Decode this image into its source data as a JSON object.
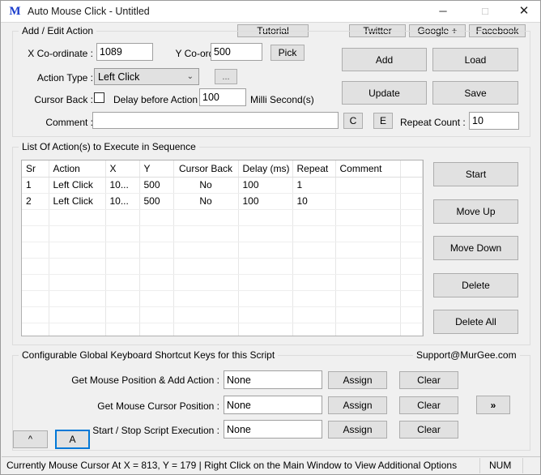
{
  "window": {
    "title": "Auto Mouse Click - Untitled",
    "icon": "M",
    "minimize": "─",
    "maximize": "□",
    "close": "✕"
  },
  "links": {
    "tutorial": "Tutorial",
    "twitter": "Twitter",
    "google_plus": "Google +",
    "facebook": "Facebook"
  },
  "add_edit": {
    "group_title": "Add / Edit Action",
    "x_label": "X Co-ordinate :",
    "x_value": "1089",
    "y_label": "Y Co-ordinate :",
    "y_value": "500",
    "pick": "Pick",
    "action_type_label": "Action Type :",
    "action_type_value": "Left Click",
    "action_type_arrow": "⌄",
    "ellipsis": "...",
    "cursor_back_label": "Cursor Back :",
    "delay_label": "Delay before Action :",
    "delay_value": "100",
    "delay_units": "Milli Second(s)",
    "comment_label": "Comment :",
    "comment_value": "",
    "add": "Add",
    "load": "Load",
    "update": "Update",
    "save": "Save",
    "c_button": "C",
    "e_button": "E",
    "repeat_count_label": "Repeat Count :",
    "repeat_count_value": "10"
  },
  "list": {
    "group_title": "List Of Action(s) to Execute in Sequence",
    "columns": [
      "Sr",
      "Action",
      "X",
      "Y",
      "Cursor Back",
      "Delay (ms)",
      "Repeat",
      "Comment",
      ""
    ],
    "rows": [
      {
        "sr": "1",
        "action": "Left Click",
        "x": "10...",
        "y": "500",
        "cursor_back": "No",
        "delay": "100",
        "repeat": "1",
        "comment": "",
        "extra": ""
      },
      {
        "sr": "2",
        "action": "Left Click",
        "x": "10...",
        "y": "500",
        "cursor_back": "No",
        "delay": "100",
        "repeat": "10",
        "comment": "",
        "extra": ""
      }
    ],
    "empty_row_count": 9,
    "buttons": {
      "start": "Start",
      "move_up": "Move Up",
      "move_down": "Move Down",
      "delete": "Delete",
      "delete_all": "Delete All"
    }
  },
  "shortcuts": {
    "group_title": "Configurable Global Keyboard Shortcut Keys for this Script",
    "support": "Support@MurGee.com",
    "rows": [
      {
        "label": "Get Mouse Position & Add Action :",
        "value": "None",
        "assign": "Assign",
        "clear": "Clear"
      },
      {
        "label": "Get Mouse Cursor Position :",
        "value": "None",
        "assign": "Assign",
        "clear": "Clear"
      },
      {
        "label": "Start / Stop Script Execution :",
        "value": "None",
        "assign": "Assign",
        "clear": "Clear"
      }
    ],
    "expand": "»",
    "collapse": "^",
    "always_on_top": "A"
  },
  "statusbar": {
    "message": "Currently Mouse Cursor At X = 813, Y = 179 | Right Click on the Main Window to View Additional Options",
    "num": "NUM"
  }
}
